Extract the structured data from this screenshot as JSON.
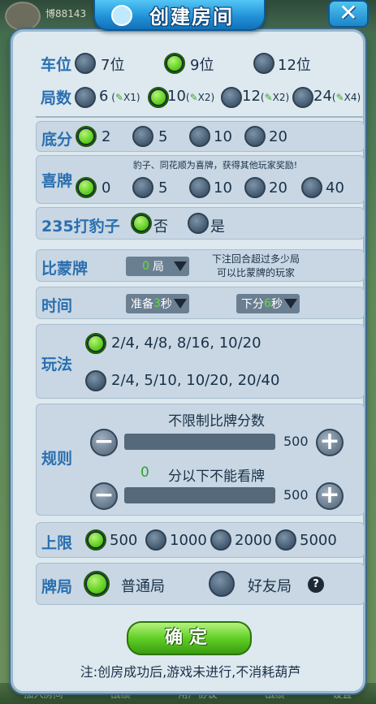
{
  "background": {
    "username": "博88143",
    "bottom_tabs": [
      "加入房间",
      "战绩",
      "用户协议",
      "战绩",
      "设置"
    ]
  },
  "header": {
    "title": "创建房间",
    "close_label": "✕"
  },
  "seats": {
    "label": "车位",
    "options": [
      "7位",
      "9位",
      "12位"
    ],
    "selected": "9位"
  },
  "rounds": {
    "label": "局数",
    "options": [
      {
        "value": "6",
        "cost": "X1"
      },
      {
        "value": "10",
        "cost": "X2"
      },
      {
        "value": "12",
        "cost": "X2"
      },
      {
        "value": "24",
        "cost": "X4"
      }
    ],
    "selected": "10"
  },
  "base_score": {
    "label": "底分",
    "options": [
      "2",
      "5",
      "10",
      "20"
    ],
    "selected": "2"
  },
  "bonus_hand": {
    "label": "喜牌",
    "note": "豹子、同花顺为喜牌，获得其他玩家奖励!",
    "options": [
      "0",
      "5",
      "10",
      "20",
      "40"
    ],
    "selected": "0"
  },
  "beat_leopard": {
    "label": "235打豹子",
    "options": [
      "否",
      "是"
    ],
    "selected": "否"
  },
  "compare_blind": {
    "label": "比蒙牌",
    "value": "0",
    "unit": "局",
    "note_line1": "下注回合超过多少局",
    "note_line2": "可以比蒙牌的玩家"
  },
  "time": {
    "label": "时间",
    "prepare_prefix": "准备",
    "prepare_value": "3",
    "prepare_suffix": "秒",
    "bet_prefix": "下分",
    "bet_value": "6",
    "bet_suffix": "秒"
  },
  "play_mode": {
    "label": "玩法",
    "options": [
      "2/4, 4/8, 8/16, 10/20",
      "2/4, 5/10, 10/20, 20/40"
    ],
    "selected": "2/4, 4/8, 8/16, 10/20"
  },
  "rules": {
    "label": "规则",
    "compare_title": "不限制比牌分数",
    "compare_value": "500",
    "look_prefix": "0",
    "look_title": "分以下不能看牌",
    "look_value": "500",
    "minus": "−",
    "plus": "+"
  },
  "limit": {
    "label": "上限",
    "options": [
      "500",
      "1000",
      "2000",
      "5000"
    ],
    "selected": "500"
  },
  "room_type": {
    "label": "牌局",
    "options": [
      "普通局",
      "好友局"
    ],
    "selected": "普通局",
    "help": "?"
  },
  "confirm_label": "确定",
  "footer_note": "注:创房成功后,游戏未进行,不消耗葫芦",
  "colors": {
    "accent_blue": "#2a6fb0",
    "radio_on": "#5ccf1b",
    "panel_bg": "#dde8ef"
  }
}
